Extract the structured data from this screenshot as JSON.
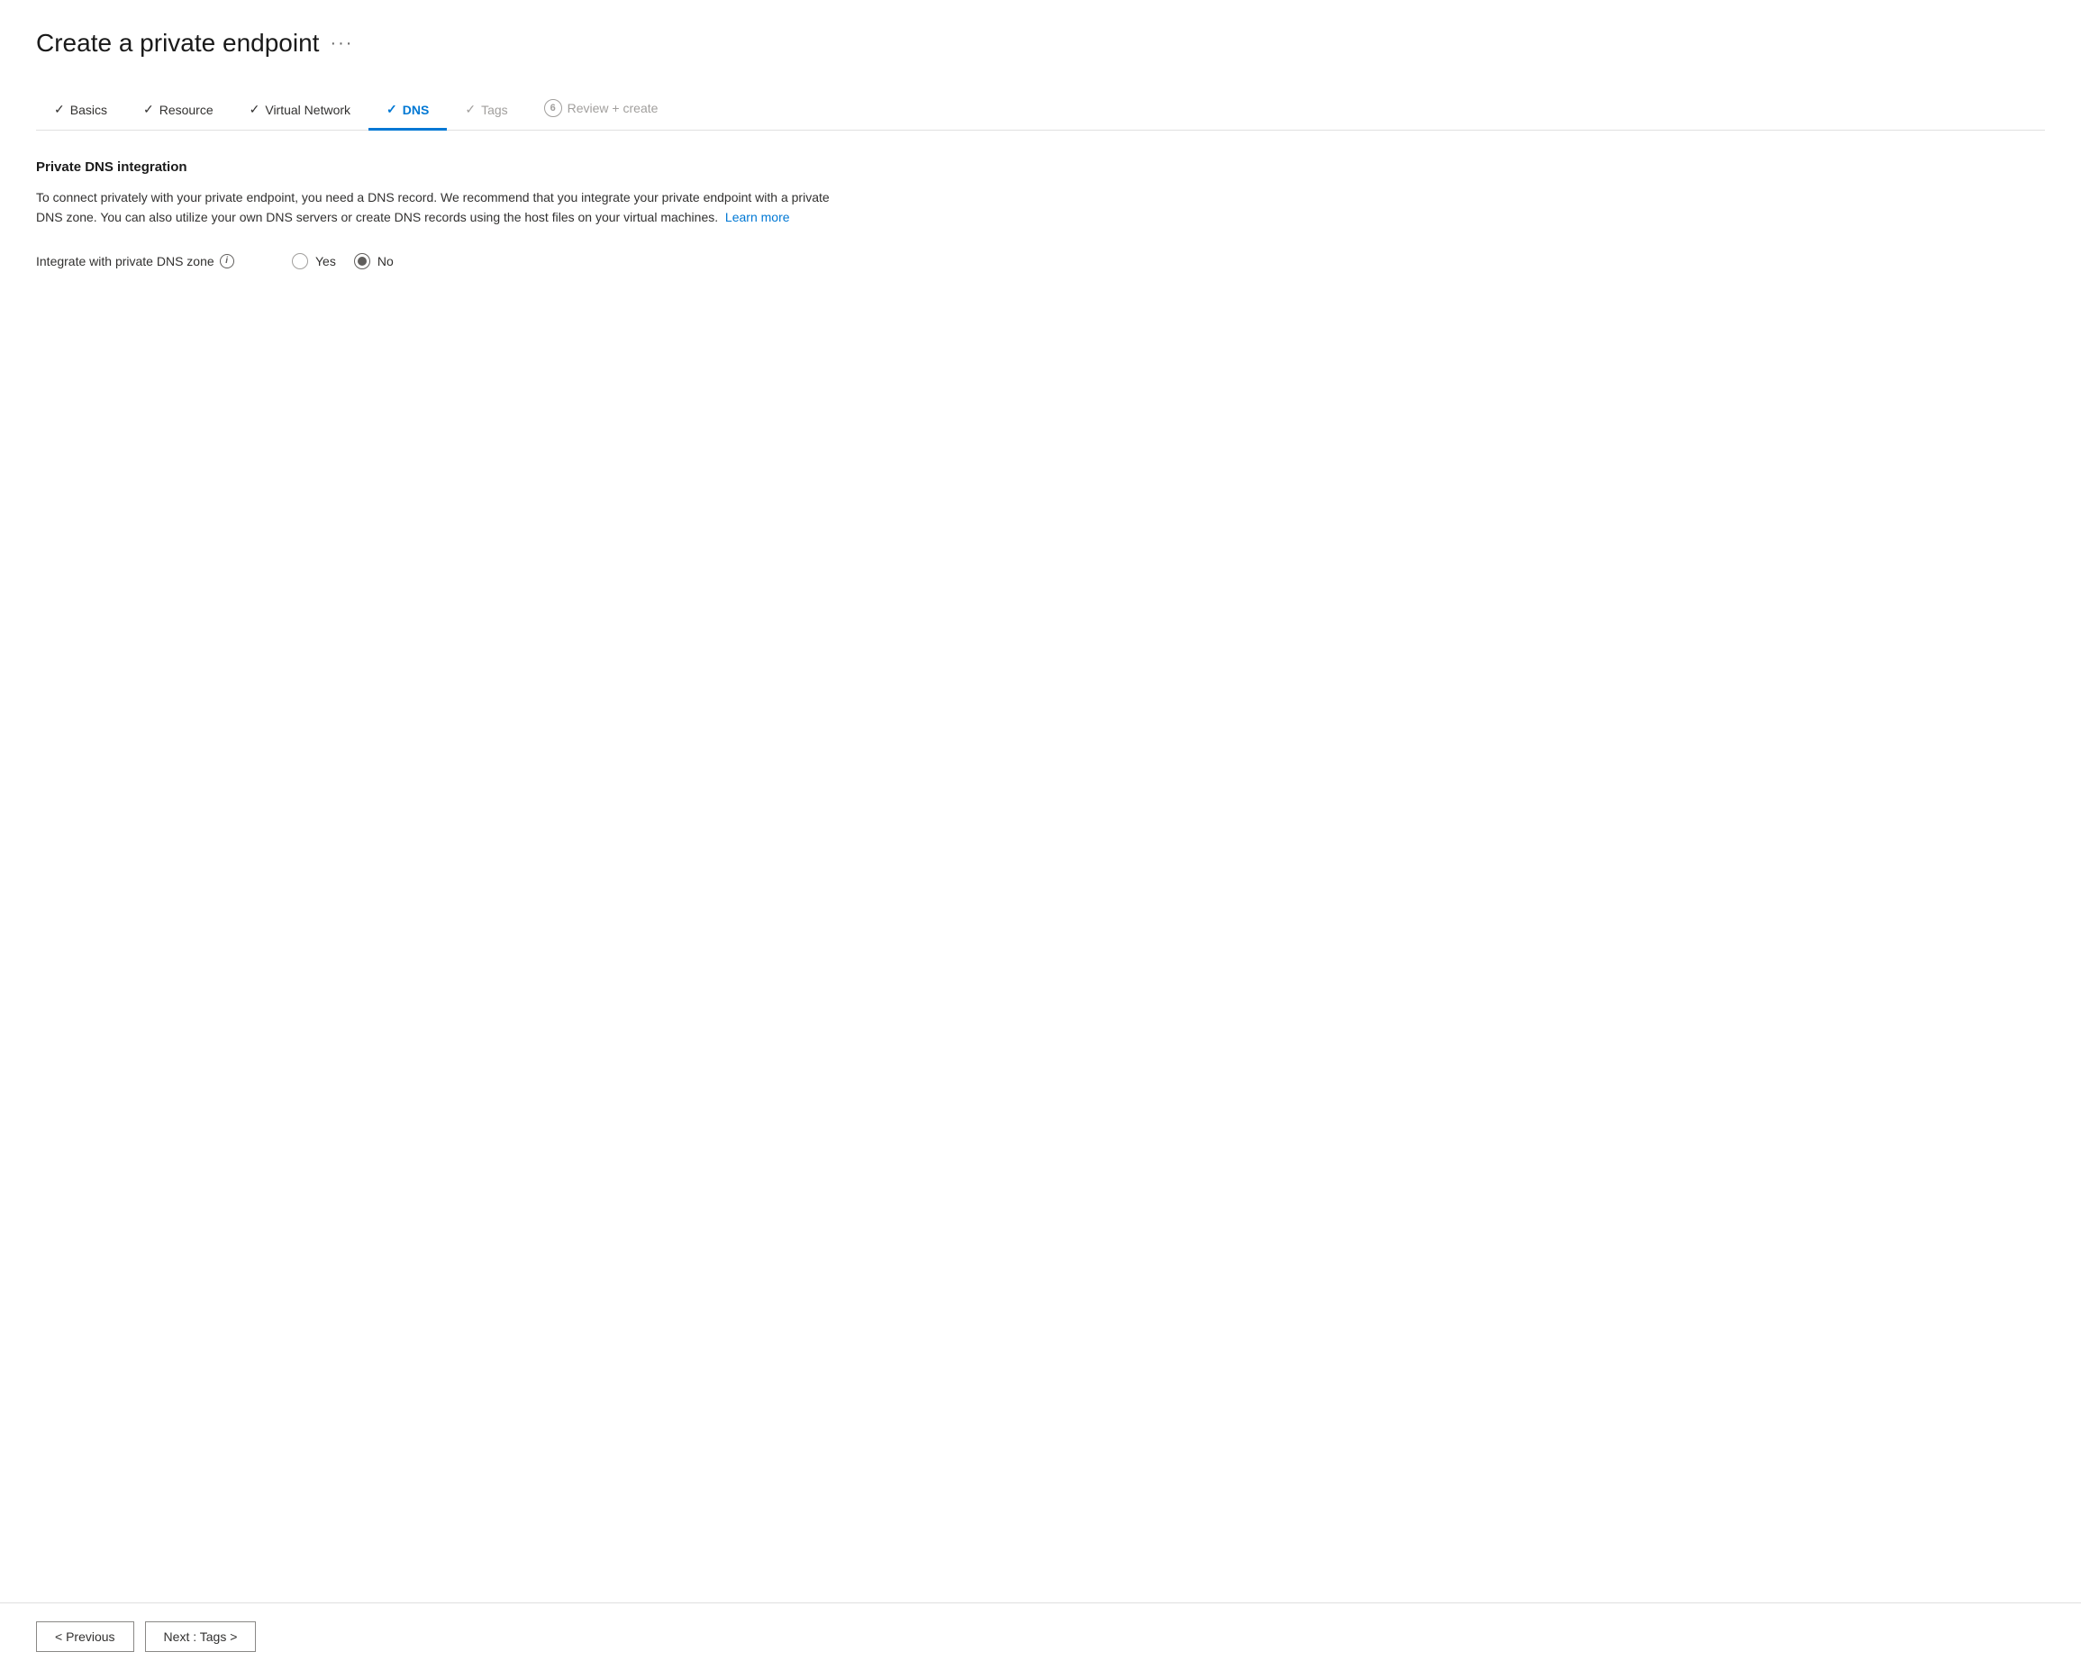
{
  "page": {
    "title": "Create a private endpoint",
    "ellipsis": "···"
  },
  "wizard": {
    "tabs": [
      {
        "id": "basics",
        "label": "Basics",
        "state": "completed",
        "check": "✓",
        "badge": null
      },
      {
        "id": "resource",
        "label": "Resource",
        "state": "completed",
        "check": "✓",
        "badge": null
      },
      {
        "id": "virtual-network",
        "label": "Virtual Network",
        "state": "completed",
        "check": "✓",
        "badge": null
      },
      {
        "id": "dns",
        "label": "DNS",
        "state": "active",
        "check": "✓",
        "badge": null
      },
      {
        "id": "tags",
        "label": "Tags",
        "state": "disabled",
        "check": "✓",
        "badge": null
      },
      {
        "id": "review-create",
        "label": "Review + create",
        "state": "disabled",
        "check": null,
        "badge": "6"
      }
    ]
  },
  "content": {
    "section_title": "Private DNS integration",
    "description": "To connect privately with your private endpoint, you need a DNS record. We recommend that you integrate your private endpoint with a private DNS zone. You can also utilize your own DNS servers or create DNS records using the host files on your virtual machines.",
    "learn_more_label": "Learn more",
    "form_label": "Integrate with private DNS zone",
    "radio_yes_label": "Yes",
    "radio_no_label": "No",
    "selected_radio": "no"
  },
  "footer": {
    "previous_label": "< Previous",
    "next_label": "Next : Tags >"
  }
}
